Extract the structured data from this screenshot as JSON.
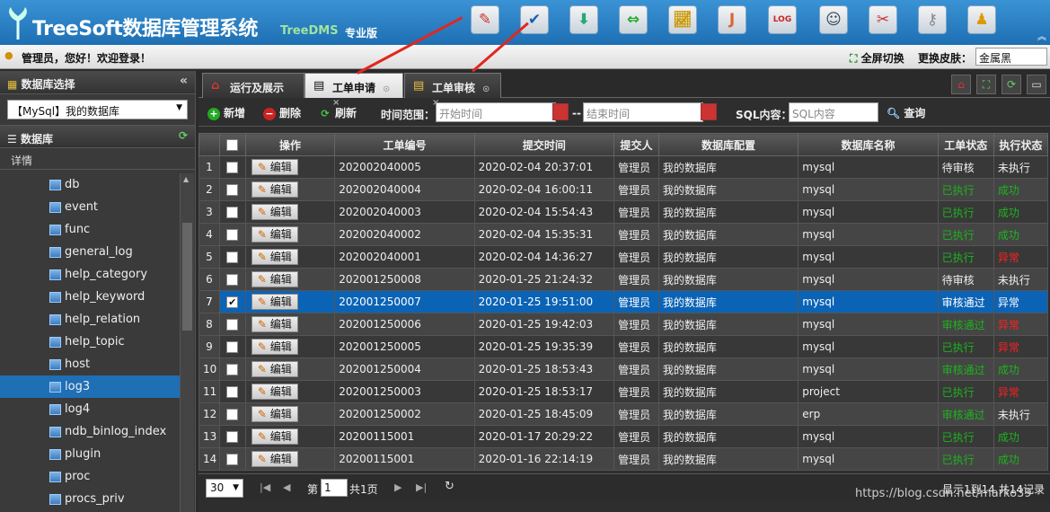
{
  "header": {
    "app_name": "TreeSoft数据库管理系统",
    "app_sub": "TreeDMS",
    "edition": "专业版",
    "toolbar_icons": [
      "sql-edit-icon",
      "check-audit-icon",
      "db-import-icon",
      "sync-icon",
      "chart-icon",
      "java-icon",
      "log-icon",
      "user-icon",
      "tools-icon",
      "key-icon",
      "help-icon"
    ]
  },
  "topbar": {
    "welcome": "管理员，您好！欢迎登录！",
    "fullscreen": "全屏切换",
    "skin_label": "更换皮肤：",
    "skin_value": "金属黑"
  },
  "left": {
    "title": "数据库选择",
    "db_selected": "【MySql】我的数据库",
    "db_header": "数据库",
    "detail": "详情",
    "tree": [
      "db",
      "event",
      "func",
      "general_log",
      "help_category",
      "help_keyword",
      "help_relation",
      "help_topic",
      "host",
      "log3",
      "log4",
      "ndb_binlog_index",
      "plugin",
      "proc",
      "procs_priv"
    ],
    "selected": "log3"
  },
  "tabs": [
    {
      "label": "运行及展示"
    },
    {
      "label": "工单申请"
    },
    {
      "label": "工单审核"
    }
  ],
  "toolbar": {
    "add": "新增",
    "delete": "删除",
    "refresh": "刷新",
    "time_range": "时间范围：",
    "start_ph": "开始时间",
    "end_ph": "结束时间",
    "sep": "--",
    "sql_label": "SQL内容：",
    "sql_ph": "SQL内容",
    "query": "查询"
  },
  "table": {
    "headers": [
      "操作",
      "工单编号",
      "提交时间",
      "提交人",
      "数据库配置",
      "数据库名称",
      "工单状态",
      "执行状态"
    ],
    "edit_label": "编辑",
    "rows": [
      [
        "1",
        "202002040005",
        "2020-02-04 20:37:01",
        "管理员",
        "我的数据库",
        "mysql",
        "待审核",
        "未执行",
        "norm",
        "norm"
      ],
      [
        "2",
        "202002040004",
        "2020-02-04 16:00:11",
        "管理员",
        "我的数据库",
        "mysql",
        "已执行",
        "成功",
        "ok",
        "ok"
      ],
      [
        "3",
        "202002040003",
        "2020-02-04 15:54:43",
        "管理员",
        "我的数据库",
        "mysql",
        "已执行",
        "成功",
        "ok",
        "ok"
      ],
      [
        "4",
        "202002040002",
        "2020-02-04 15:35:31",
        "管理员",
        "我的数据库",
        "mysql",
        "已执行",
        "成功",
        "ok",
        "ok"
      ],
      [
        "5",
        "202002040001",
        "2020-02-04 14:36:27",
        "管理员",
        "我的数据库",
        "mysql",
        "已执行",
        "异常",
        "ok",
        "err"
      ],
      [
        "6",
        "202001250008",
        "2020-01-25 21:24:32",
        "管理员",
        "我的数据库",
        "mysql",
        "待审核",
        "未执行",
        "norm",
        "norm"
      ],
      [
        "7",
        "202001250007",
        "2020-01-25 19:51:00",
        "管理员",
        "我的数据库",
        "mysql",
        "审核通过",
        "异常",
        "ok",
        "err"
      ],
      [
        "8",
        "202001250006",
        "2020-01-25 19:42:03",
        "管理员",
        "我的数据库",
        "mysql",
        "审核通过",
        "异常",
        "ok",
        "err"
      ],
      [
        "9",
        "202001250005",
        "2020-01-25 19:35:39",
        "管理员",
        "我的数据库",
        "mysql",
        "已执行",
        "异常",
        "ok",
        "err"
      ],
      [
        "10",
        "202001250004",
        "2020-01-25 18:53:43",
        "管理员",
        "我的数据库",
        "mysql",
        "审核通过",
        "成功",
        "ok",
        "ok"
      ],
      [
        "11",
        "202001250003",
        "2020-01-25 18:53:17",
        "管理员",
        "我的数据库",
        "project",
        "已执行",
        "异常",
        "ok",
        "err"
      ],
      [
        "12",
        "202001250002",
        "2020-01-25 18:45:09",
        "管理员",
        "我的数据库",
        "erp",
        "审核通过",
        "未执行",
        "ok",
        "norm"
      ],
      [
        "13",
        "20200115001",
        "2020-01-17 20:29:22",
        "管理员",
        "我的数据库",
        "mysql",
        "已执行",
        "成功",
        "ok",
        "ok"
      ],
      [
        "14",
        "20200115001",
        "2020-01-16 22:14:19",
        "管理员",
        "我的数据库",
        "mysql",
        "已执行",
        "成功",
        "ok",
        "ok"
      ]
    ],
    "selected_row": 7
  },
  "pager": {
    "page_size": "30",
    "page_prefix": "第",
    "page_value": "1",
    "page_total": "共1页",
    "info": "显示1到14,共14记录"
  },
  "watermark": "https://blog.csdn.net/marko39",
  "colors": {
    "brand": "#2a86cc",
    "ok": "#1db31d",
    "err": "#ff2020",
    "selected": "#0b63b6",
    "arrow": "#e3261e"
  }
}
